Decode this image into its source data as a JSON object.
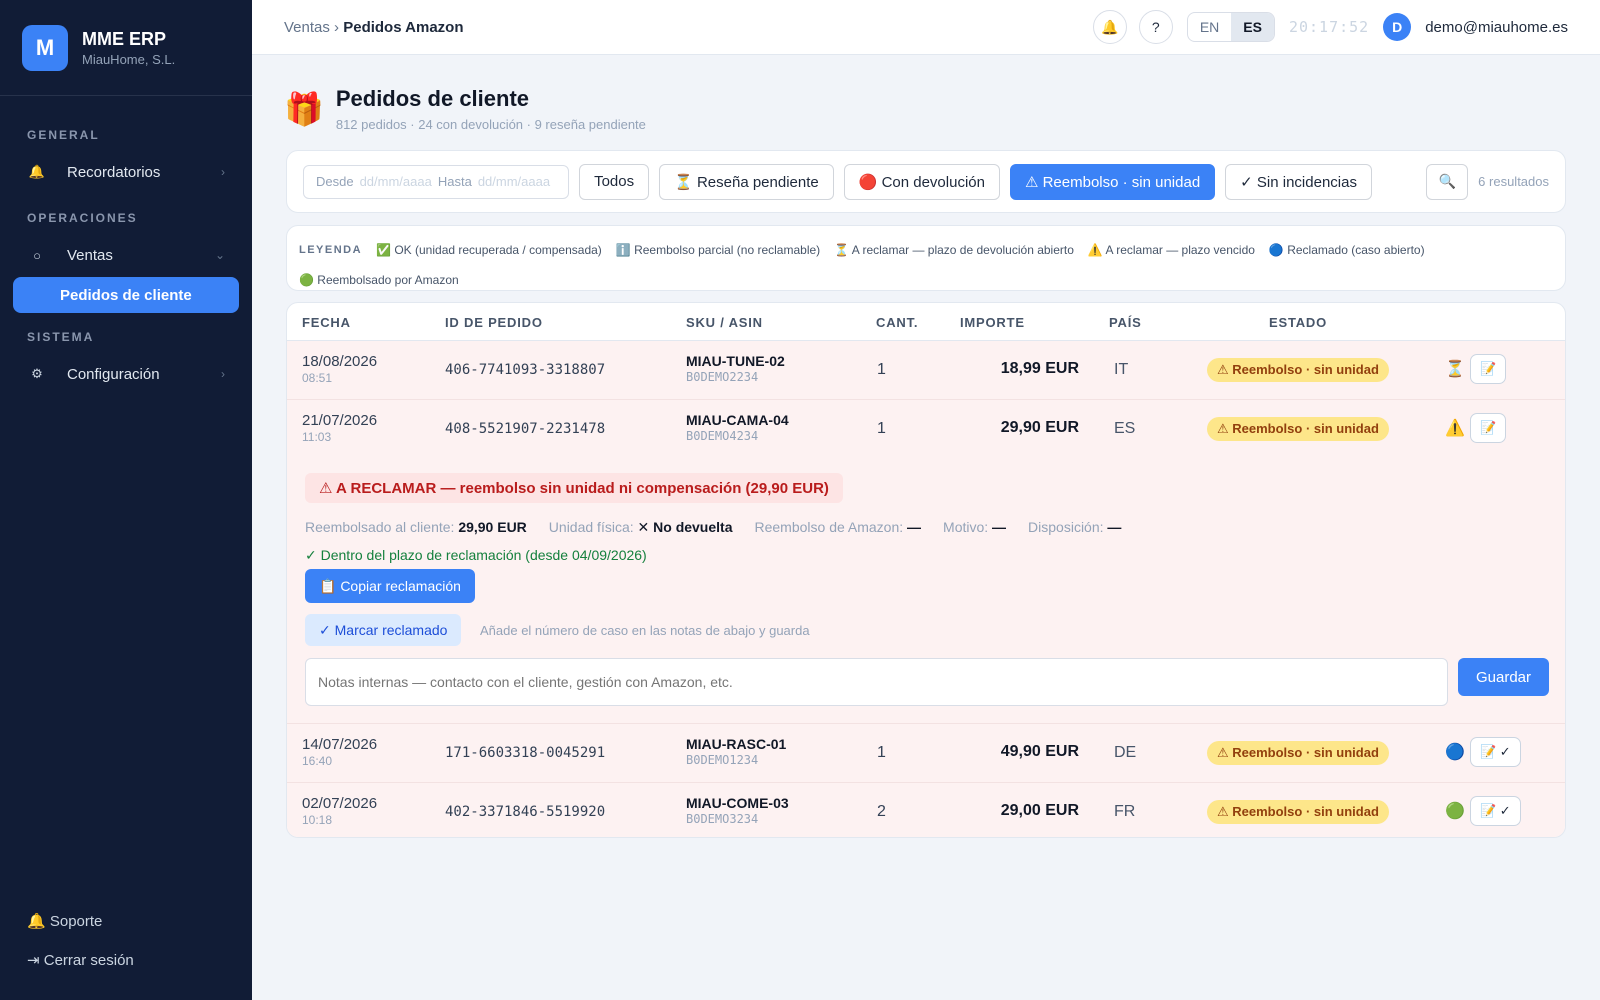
{
  "brand": {
    "logo": "M",
    "name": "MME ERP",
    "company": "MiauHome, S.L."
  },
  "sidebar": {
    "sections": [
      "GENERAL",
      "OPERACIONES",
      "SISTEMA"
    ],
    "items": [
      {
        "label": "Recordatorios",
        "icon": "bell-icon",
        "glyph": "🔔",
        "chevron": "›"
      },
      {
        "label": "Ventas",
        "icon": "circle-icon",
        "glyph": "○",
        "chevron": "⌄"
      },
      {
        "label": "Pedidos de cliente"
      },
      {
        "label": "Configuración",
        "icon": "gear-icon",
        "glyph": "⚙",
        "chevron": "›"
      }
    ],
    "support": "🔔 Soporte",
    "logout": "⇥ Cerrar sesión"
  },
  "topbar": {
    "crumb_parent": "Ventas",
    "crumb_sep": " › ",
    "crumb_current": "Pedidos Amazon",
    "bell_glyph": "🔔",
    "help_glyph": "?",
    "lang_en": "EN",
    "lang_es": "ES",
    "clock": "20:17:52",
    "avatar": "D",
    "user": "demo@miauhome.es"
  },
  "page": {
    "icon_glyph": "🎁",
    "title": "Pedidos de cliente",
    "subtitle": "812 pedidos · 24 con devolución · 9 reseña pendiente"
  },
  "filters": {
    "from_label": "Desde",
    "from_placeholder": "dd/mm/aaaa",
    "to_label": "Hasta",
    "to_placeholder": "dd/mm/aaaa",
    "buttons": [
      "Todos",
      "⏳ Reseña pendiente",
      "🔴 Con devolución",
      "⚠ Reembolso · sin unidad",
      "✓ Sin incidencias"
    ],
    "active_index": 3,
    "search_glyph": "🔍",
    "results": "6 resultados"
  },
  "legend": {
    "title": "LEYENDA",
    "items": [
      "✅ OK (unidad recuperada / compensada)",
      "ℹ️ Reembolso parcial (no reclamable)",
      "⏳ A reclamar — plazo de devolución abierto",
      "⚠️ A reclamar — plazo vencido",
      "🔵 Reclamado (caso abierto)",
      "🟢 Reembolsado por Amazon"
    ]
  },
  "table": {
    "headers": [
      "FECHA",
      "ID DE PEDIDO",
      "SKU / ASIN",
      "CANT.",
      "IMPORTE",
      "PAÍS",
      "ESTADO"
    ],
    "rows": [
      {
        "date": "18/08/2026",
        "time": "08:51",
        "order_id": "406-7741093-3318807",
        "sku": "MIAU-TUNE-02",
        "asin": "B0DEMO2234",
        "qty": "1",
        "amount": "18,99 EUR",
        "country": "IT",
        "status": "⚠ Reembolso · sin unidad",
        "status_glyph": "⏳",
        "action": "📝"
      },
      {
        "date": "21/07/2026",
        "time": "11:03",
        "order_id": "408-5521907-2231478",
        "sku": "MIAU-CAMA-04",
        "asin": "B0DEMO4234",
        "qty": "1",
        "amount": "29,90 EUR",
        "country": "ES",
        "status": "⚠ Reembolso · sin unidad",
        "status_glyph": "⚠️",
        "action": "📝"
      },
      {
        "date": "14/07/2026",
        "time": "16:40",
        "order_id": "171-6603318-0045291",
        "sku": "MIAU-RASC-01",
        "asin": "B0DEMO1234",
        "qty": "1",
        "amount": "49,90 EUR",
        "country": "DE",
        "status": "⚠ Reembolso · sin unidad",
        "status_glyph": "🔵",
        "action": "📝 ✓"
      },
      {
        "date": "02/07/2026",
        "time": "10:18",
        "order_id": "402-3371846-5519920",
        "sku": "MIAU-COME-03",
        "asin": "B0DEMO3234",
        "qty": "2",
        "amount": "29,00 EUR",
        "country": "FR",
        "status": "⚠ Reembolso · sin unidad",
        "status_glyph": "🟢",
        "action": "📝 ✓"
      }
    ]
  },
  "detail": {
    "title": "⚠ A RECLAMAR — reembolso sin unidad ni compensación (29,90 EUR)",
    "refunded_label": "Reembolsado al cliente:",
    "refunded_value": "29,90 EUR",
    "unit_label": "Unidad física:",
    "unit_value": "✕ No devuelta",
    "amazon_label": "Reembolso de Amazon:",
    "amazon_value": "—",
    "reason_label": "Motivo:",
    "reason_value": "—",
    "disposition_label": "Disposición:",
    "disposition_value": "—",
    "deadline": "✓ Dentro del plazo de reclamación (desde 04/09/2026)",
    "copy_button": "📋 Copiar reclamación",
    "mark_button": "✓ Marcar reclamado",
    "mark_hint": "Añade el número de caso en las notas de abajo y guarda",
    "notes_placeholder": "Notas internas — contacto con el cliente, gestión con Amazon, etc.",
    "save_button": "Guardar"
  }
}
